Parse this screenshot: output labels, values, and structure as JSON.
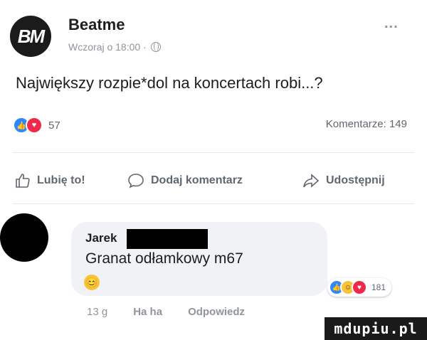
{
  "post": {
    "author": "Beatme",
    "avatar_text": "BM",
    "meta": "Wczoraj o 18:00 ·",
    "more": "...",
    "text": "Największy rozpie*dol na koncertach robi...?",
    "reaction_count": "57",
    "comments": "Komentarze: 149"
  },
  "actions": {
    "like": "Lubię to!",
    "comment": "Dodaj komentarz",
    "share": "Udostępnij"
  },
  "comment": {
    "author": "Jarek",
    "text": "Granat odłamkowy m67",
    "emoji": "😊",
    "reaction_count": "181",
    "time": "13 g",
    "haha": "Ha ha",
    "reply": "Odpowiedz"
  },
  "watermark": "mdupiu.pl",
  "colors": {
    "like": "#2d88ff",
    "love": "#f02849",
    "haha": "#f7c33b",
    "muted": "#606770"
  }
}
